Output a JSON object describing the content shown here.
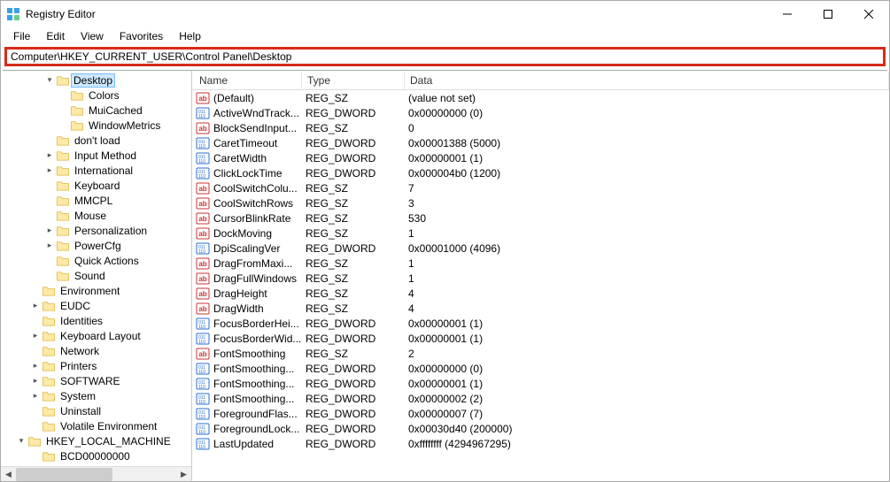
{
  "window": {
    "title": "Registry Editor"
  },
  "menu": [
    "File",
    "Edit",
    "View",
    "Favorites",
    "Help"
  ],
  "address": "Computer\\HKEY_CURRENT_USER\\Control Panel\\Desktop",
  "tree": [
    {
      "indent": 3,
      "twisty": "down",
      "label": "Desktop",
      "selected": true
    },
    {
      "indent": 4,
      "twisty": "",
      "label": "Colors"
    },
    {
      "indent": 4,
      "twisty": "",
      "label": "MuiCached"
    },
    {
      "indent": 4,
      "twisty": "",
      "label": "WindowMetrics"
    },
    {
      "indent": 3,
      "twisty": "",
      "label": "don't load"
    },
    {
      "indent": 3,
      "twisty": "right",
      "label": "Input Method"
    },
    {
      "indent": 3,
      "twisty": "right",
      "label": "International"
    },
    {
      "indent": 3,
      "twisty": "",
      "label": "Keyboard"
    },
    {
      "indent": 3,
      "twisty": "",
      "label": "MMCPL"
    },
    {
      "indent": 3,
      "twisty": "",
      "label": "Mouse"
    },
    {
      "indent": 3,
      "twisty": "right",
      "label": "Personalization"
    },
    {
      "indent": 3,
      "twisty": "right",
      "label": "PowerCfg"
    },
    {
      "indent": 3,
      "twisty": "",
      "label": "Quick Actions"
    },
    {
      "indent": 3,
      "twisty": "",
      "label": "Sound"
    },
    {
      "indent": 2,
      "twisty": "",
      "label": "Environment"
    },
    {
      "indent": 2,
      "twisty": "right",
      "label": "EUDC"
    },
    {
      "indent": 2,
      "twisty": "",
      "label": "Identities"
    },
    {
      "indent": 2,
      "twisty": "right",
      "label": "Keyboard Layout"
    },
    {
      "indent": 2,
      "twisty": "",
      "label": "Network"
    },
    {
      "indent": 2,
      "twisty": "right",
      "label": "Printers"
    },
    {
      "indent": 2,
      "twisty": "right",
      "label": "SOFTWARE"
    },
    {
      "indent": 2,
      "twisty": "right",
      "label": "System"
    },
    {
      "indent": 2,
      "twisty": "",
      "label": "Uninstall"
    },
    {
      "indent": 2,
      "twisty": "",
      "label": "Volatile Environment"
    },
    {
      "indent": 1,
      "twisty": "down",
      "label": "HKEY_LOCAL_MACHINE"
    },
    {
      "indent": 2,
      "twisty": "",
      "label": "BCD00000000"
    }
  ],
  "columns": {
    "name": "Name",
    "type": "Type",
    "data": "Data"
  },
  "values": [
    {
      "icon": "sz",
      "name": "(Default)",
      "type": "REG_SZ",
      "data": "(value not set)"
    },
    {
      "icon": "dw",
      "name": "ActiveWndTrack...",
      "type": "REG_DWORD",
      "data": "0x00000000 (0)"
    },
    {
      "icon": "sz",
      "name": "BlockSendInput...",
      "type": "REG_SZ",
      "data": "0"
    },
    {
      "icon": "dw",
      "name": "CaretTimeout",
      "type": "REG_DWORD",
      "data": "0x00001388 (5000)"
    },
    {
      "icon": "dw",
      "name": "CaretWidth",
      "type": "REG_DWORD",
      "data": "0x00000001 (1)"
    },
    {
      "icon": "dw",
      "name": "ClickLockTime",
      "type": "REG_DWORD",
      "data": "0x000004b0 (1200)"
    },
    {
      "icon": "sz",
      "name": "CoolSwitchColu...",
      "type": "REG_SZ",
      "data": "7"
    },
    {
      "icon": "sz",
      "name": "CoolSwitchRows",
      "type": "REG_SZ",
      "data": "3"
    },
    {
      "icon": "sz",
      "name": "CursorBlinkRate",
      "type": "REG_SZ",
      "data": "530"
    },
    {
      "icon": "sz",
      "name": "DockMoving",
      "type": "REG_SZ",
      "data": "1"
    },
    {
      "icon": "dw",
      "name": "DpiScalingVer",
      "type": "REG_DWORD",
      "data": "0x00001000 (4096)"
    },
    {
      "icon": "sz",
      "name": "DragFromMaxi...",
      "type": "REG_SZ",
      "data": "1"
    },
    {
      "icon": "sz",
      "name": "DragFullWindows",
      "type": "REG_SZ",
      "data": "1"
    },
    {
      "icon": "sz",
      "name": "DragHeight",
      "type": "REG_SZ",
      "data": "4"
    },
    {
      "icon": "sz",
      "name": "DragWidth",
      "type": "REG_SZ",
      "data": "4"
    },
    {
      "icon": "dw",
      "name": "FocusBorderHei...",
      "type": "REG_DWORD",
      "data": "0x00000001 (1)"
    },
    {
      "icon": "dw",
      "name": "FocusBorderWid...",
      "type": "REG_DWORD",
      "data": "0x00000001 (1)"
    },
    {
      "icon": "sz",
      "name": "FontSmoothing",
      "type": "REG_SZ",
      "data": "2"
    },
    {
      "icon": "dw",
      "name": "FontSmoothing...",
      "type": "REG_DWORD",
      "data": "0x00000000 (0)"
    },
    {
      "icon": "dw",
      "name": "FontSmoothing...",
      "type": "REG_DWORD",
      "data": "0x00000001 (1)"
    },
    {
      "icon": "dw",
      "name": "FontSmoothing...",
      "type": "REG_DWORD",
      "data": "0x00000002 (2)"
    },
    {
      "icon": "dw",
      "name": "ForegroundFlas...",
      "type": "REG_DWORD",
      "data": "0x00000007 (7)"
    },
    {
      "icon": "dw",
      "name": "ForegroundLock...",
      "type": "REG_DWORD",
      "data": "0x00030d40 (200000)"
    },
    {
      "icon": "dw",
      "name": "LastUpdated",
      "type": "REG_DWORD",
      "data": "0xffffffff (4294967295)"
    }
  ]
}
